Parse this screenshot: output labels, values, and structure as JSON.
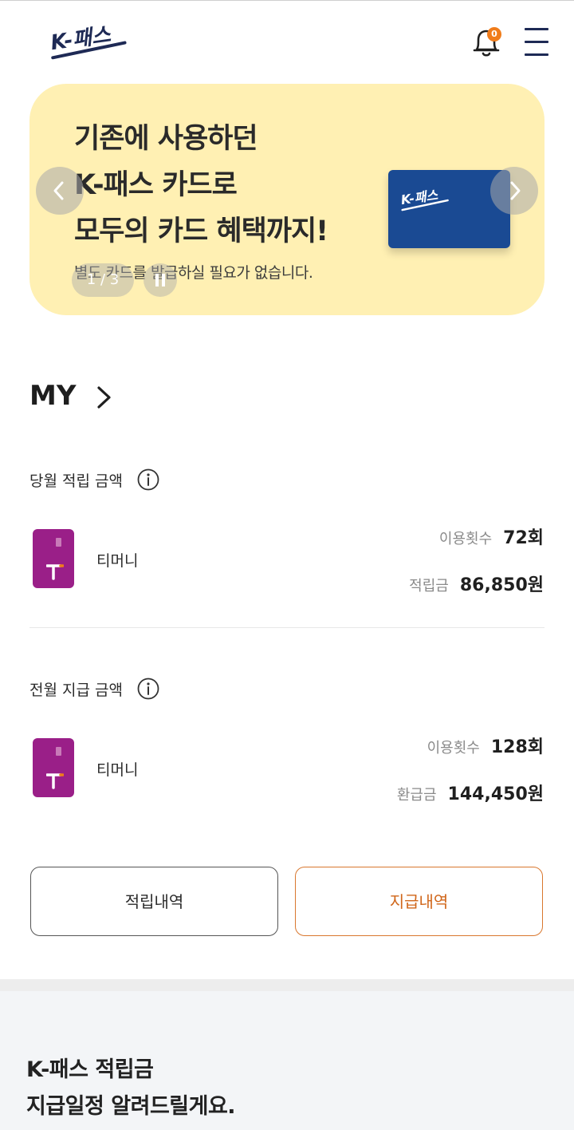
{
  "header": {
    "logo_text": "K-패스",
    "notification_count": "0"
  },
  "banner": {
    "headline_lines": [
      "기존에 사용하던",
      "K-패스 카드로",
      "모두의 카드 혜택까지!"
    ],
    "subtext": "별도 카드를 발급하실 필요가 없습니다.",
    "card_logo_text": "K-패스",
    "pager": "1 / 3"
  },
  "my": {
    "title": "MY"
  },
  "current_month": {
    "label": "당월 적립 금액",
    "card_name": "티머니",
    "usage_label": "이용횟수",
    "usage_value": "72회",
    "amount_label": "적립금",
    "amount_value": "86,850원"
  },
  "previous_month": {
    "label": "전월 지급 금액",
    "card_name": "티머니",
    "usage_label": "이용횟수",
    "usage_value": "128회",
    "amount_label": "환급금",
    "amount_value": "144,450원"
  },
  "buttons": {
    "accrual_history": "적립내역",
    "payment_history": "지급내역"
  },
  "schedule": {
    "title_lines": [
      "K-패스 적립금",
      "지급일정 알려드릴게요."
    ]
  },
  "colors": {
    "banner_bg": "#fff0b3",
    "brand_navy": "#1e2a55",
    "accent_orange": "#f07c1a",
    "card_magenta": "#9a1f88",
    "kpass_card_blue": "#1a4a93"
  },
  "icons": [
    "k-pass-logo",
    "bell-icon",
    "hamburger-menu-icon",
    "chevron-left-icon",
    "chevron-right-icon",
    "pause-icon",
    "info-icon",
    "tmoney-card-icon"
  ]
}
